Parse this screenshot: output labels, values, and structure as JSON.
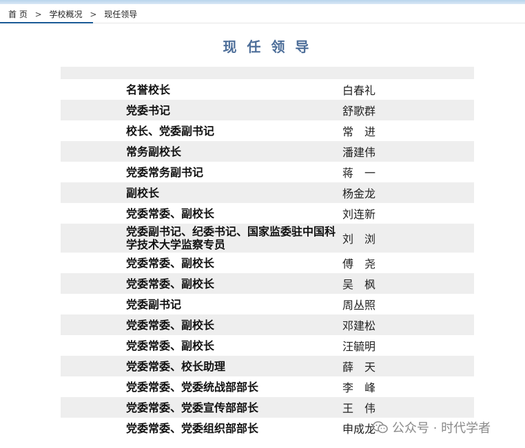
{
  "breadcrumb": {
    "items": [
      "首 页",
      "学校概况",
      "现任领导"
    ],
    "separator": ">"
  },
  "page_title": "现 任 领 导",
  "leaders": [
    {
      "title": "名誉校长",
      "name": "白春礼"
    },
    {
      "title": "党委书记",
      "name": "舒歌群"
    },
    {
      "title": "校长、党委副书记",
      "name": "常　进"
    },
    {
      "title": "常务副校长",
      "name": "潘建伟"
    },
    {
      "title": "党委常务副书记",
      "name": "蒋　一"
    },
    {
      "title": "副校长",
      "name": "杨金龙"
    },
    {
      "title": "党委常委、副校长",
      "name": "刘连新"
    },
    {
      "title": "党委副书记、纪委书记、国家监委驻中国科学技术大学监察专员",
      "name": "刘　浏"
    },
    {
      "title": "党委常委、副校长",
      "name": "傅　尧"
    },
    {
      "title": "党委常委、副校长",
      "name": "吴　枫"
    },
    {
      "title": "党委副书记",
      "name": "周丛照"
    },
    {
      "title": "党委常委、副校长",
      "name": "邓建松"
    },
    {
      "title": "党委常委、副校长",
      "name": "汪毓明"
    },
    {
      "title": "党委常委、校长助理",
      "name": "薛　天"
    },
    {
      "title": "党委常委、党委统战部部长",
      "name": "李　峰"
    },
    {
      "title": "党委常委、党委宣传部部长",
      "name": "王　伟"
    },
    {
      "title": "党委常委、党委组织部部长",
      "name": "申成龙"
    }
  ],
  "watermark": {
    "text": "公众号 · 时代学者",
    "icon": "wechat-icon"
  },
  "colors": {
    "title": "#4d6e99",
    "row_shade": "#eeeeee",
    "breadcrumb_accent": "#1a5a96"
  }
}
